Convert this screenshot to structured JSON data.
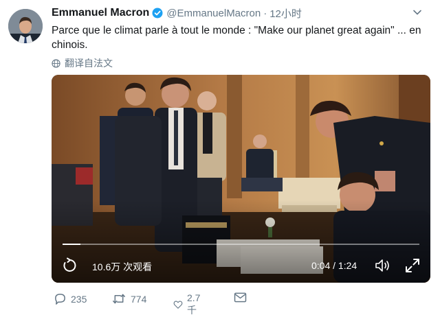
{
  "tweet": {
    "display_name": "Emmanuel Macron",
    "handle": "@EmmanuelMacron",
    "separator": "·",
    "time": "12小时",
    "text": "Parce que le climat parle à tout le monde : \"Make our planet great again\" ... en chinois.",
    "translate_label": "翻译自法文"
  },
  "video": {
    "views": "10.6万 次观看",
    "timecode": "0:04 / 1:24",
    "progress": 0.05
  },
  "actions": {
    "reply_count": "235",
    "retweet_count": "774",
    "like_count": "2.7千"
  },
  "colors": {
    "verified": "#1da1f2",
    "secondary_text": "#657786"
  }
}
